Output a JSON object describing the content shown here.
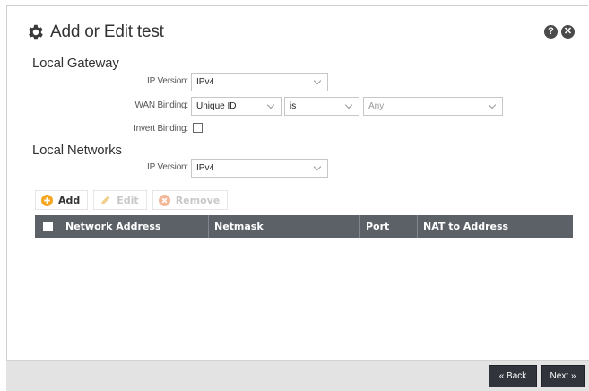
{
  "dialog": {
    "title": "Add or Edit test",
    "help_icon": "question-icon",
    "close_icon": "close-icon"
  },
  "local_gateway": {
    "heading": "Local Gateway",
    "ip_version_label": "IP Version:",
    "ip_version_value": "IPv4",
    "wan_binding_label": "WAN Binding:",
    "wan_binding_value": "Unique ID",
    "wan_binding_operator": "is",
    "wan_binding_target": "Any",
    "invert_binding_label": "Invert Binding:",
    "invert_binding_checked": false
  },
  "local_networks": {
    "heading": "Local Networks",
    "ip_version_label": "IP Version:",
    "ip_version_value": "IPv4"
  },
  "toolbar": {
    "add_label": "Add",
    "edit_label": "Edit",
    "remove_label": "Remove"
  },
  "grid": {
    "columns": [
      "Network Address",
      "Netmask",
      "Port",
      "NAT to Address"
    ],
    "rows": []
  },
  "footer": {
    "back_label": "« Back",
    "next_label": "Next »"
  },
  "colors": {
    "header_bg": "#5c6168",
    "add_icon": "#f5a623",
    "remove_icon": "#f3b89a",
    "edit_icon": "#f2cf8a",
    "footer_button": "#31353b"
  }
}
